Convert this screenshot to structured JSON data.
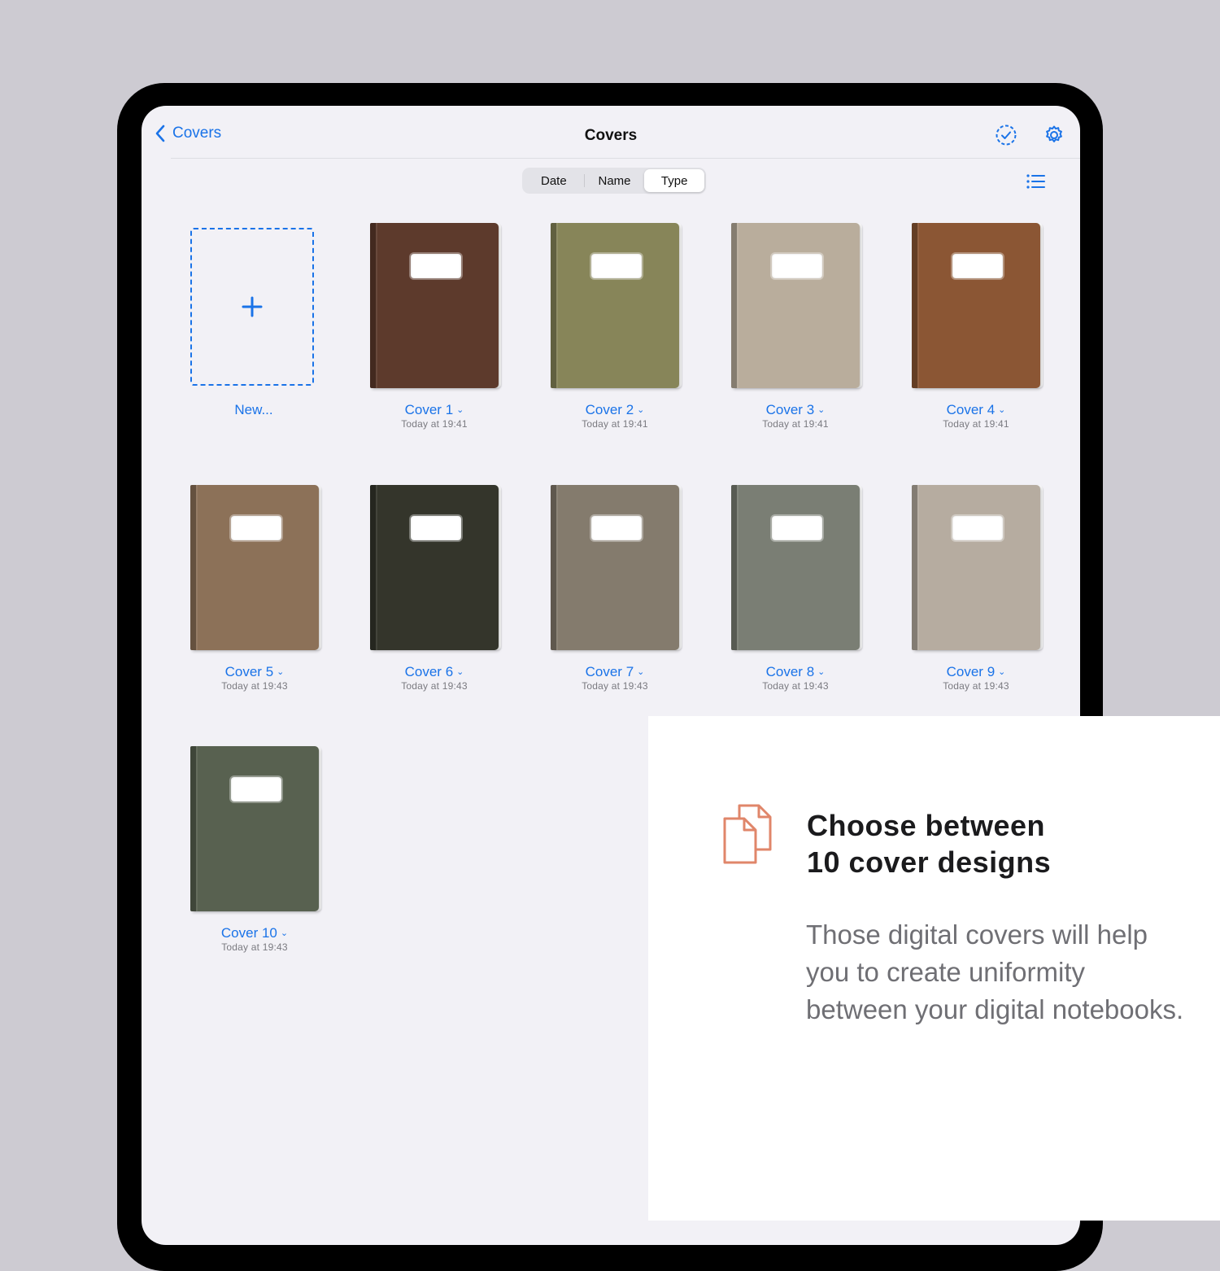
{
  "navbar": {
    "back_label": "Covers",
    "title": "Covers",
    "icons": [
      "select-circle-icon",
      "gear-icon"
    ]
  },
  "sort": {
    "options": [
      "Date",
      "Name",
      "Type"
    ],
    "selected": "Type"
  },
  "new_item": {
    "label": "New..."
  },
  "covers": [
    {
      "name": "Cover 1",
      "date": "Today at 19:41",
      "color": "#5d3a2c"
    },
    {
      "name": "Cover 2",
      "date": "Today at 19:41",
      "color": "#878559"
    },
    {
      "name": "Cover 3",
      "date": "Today at 19:41",
      "color": "#b9ad9c"
    },
    {
      "name": "Cover 4",
      "date": "Today at 19:41",
      "color": "#8b5634"
    },
    {
      "name": "Cover 5",
      "date": "Today at 19:43",
      "color": "#8c7158"
    },
    {
      "name": "Cover 6",
      "date": "Today at 19:43",
      "color": "#34352b"
    },
    {
      "name": "Cover 7",
      "date": "Today at 19:43",
      "color": "#847b6d"
    },
    {
      "name": "Cover 8",
      "date": "Today at 19:43",
      "color": "#7a7e74"
    },
    {
      "name": "Cover 9",
      "date": "Today at 19:43",
      "color": "#b6aca0"
    },
    {
      "name": "Cover 10",
      "date": "Today at 19:43",
      "color": "#586150"
    }
  ],
  "feature": {
    "title_line1": "Choose between",
    "title_line2": "10 cover designs",
    "body": "Those digital covers will help you to create uniformity between your digital notebooks."
  },
  "colors": {
    "accent": "#1a73e8",
    "feature_icon": "#e0866a",
    "background": "#cdcbd2"
  }
}
